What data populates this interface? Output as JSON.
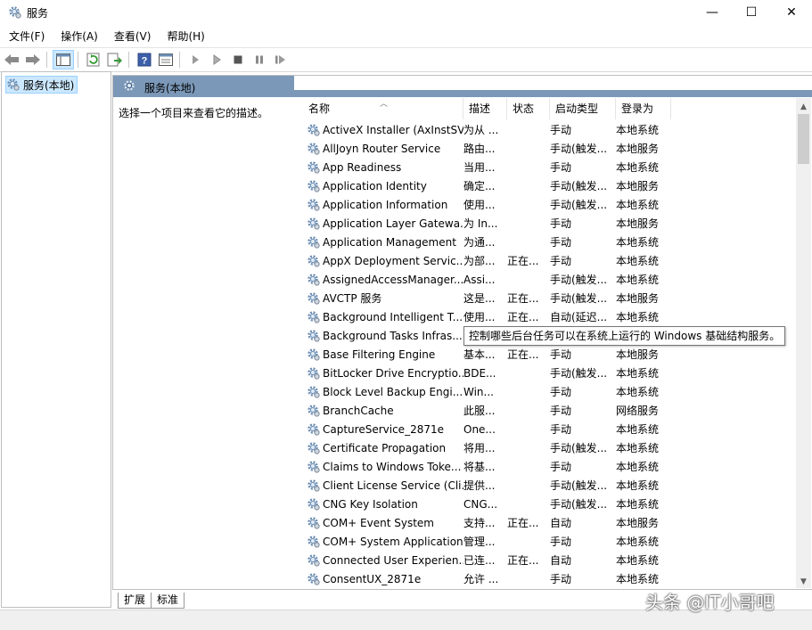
{
  "window": {
    "title": "服务",
    "minimize": "—",
    "maximize": "☐",
    "close": "✕"
  },
  "menu": [
    "文件(F)",
    "操作(A)",
    "查看(V)",
    "帮助(H)"
  ],
  "toolbar": {
    "icons": [
      "back-arrow-icon",
      "forward-arrow-icon",
      "console-tree-icon",
      "refresh-icon",
      "export-icon",
      "help-icon",
      "properties-icon",
      "start-service-icon",
      "start-alt-icon",
      "stop-icon",
      "pause-icon",
      "restart-icon"
    ]
  },
  "tree": {
    "item": "服务(本地)"
  },
  "panel": {
    "header": "服务(本地)",
    "description": "选择一个项目来查看它的描述。"
  },
  "columns": {
    "name": "名称",
    "desc": "描述",
    "state": "状态",
    "startup": "启动类型",
    "logon": "登录为"
  },
  "services": [
    {
      "name": "ActiveX Installer (AxInstSV)",
      "desc": "为从 ...",
      "state": "",
      "startup": "手动",
      "logon": "本地系统"
    },
    {
      "name": "AllJoyn Router Service",
      "desc": "路由...",
      "state": "",
      "startup": "手动(触发...",
      "logon": "本地服务"
    },
    {
      "name": "App Readiness",
      "desc": "当用...",
      "state": "",
      "startup": "手动",
      "logon": "本地系统"
    },
    {
      "name": "Application Identity",
      "desc": "确定...",
      "state": "",
      "startup": "手动(触发...",
      "logon": "本地服务"
    },
    {
      "name": "Application Information",
      "desc": "使用...",
      "state": "",
      "startup": "手动(触发...",
      "logon": "本地系统"
    },
    {
      "name": "Application Layer Gatewa...",
      "desc": "为 In...",
      "state": "",
      "startup": "手动",
      "logon": "本地服务"
    },
    {
      "name": "Application Management",
      "desc": "为通...",
      "state": "",
      "startup": "手动",
      "logon": "本地系统"
    },
    {
      "name": "AppX Deployment Servic...",
      "desc": "为部...",
      "state": "正在...",
      "startup": "手动",
      "logon": "本地系统"
    },
    {
      "name": "AssignedAccessManager...",
      "desc": "Assi...",
      "state": "",
      "startup": "手动(触发...",
      "logon": "本地系统"
    },
    {
      "name": "AVCTP 服务",
      "desc": "这是...",
      "state": "正在...",
      "startup": "手动(触发...",
      "logon": "本地服务"
    },
    {
      "name": "Background Intelligent T...",
      "desc": "使用...",
      "state": "正在...",
      "startup": "自动(延迟...",
      "logon": "本地系统"
    },
    {
      "name": "Background Tasks Infras...",
      "desc": "",
      "state": "",
      "startup": "",
      "logon": ""
    },
    {
      "name": "Base Filtering Engine",
      "desc": "基本...",
      "state": "正在...",
      "startup": "手动",
      "logon": "本地服务"
    },
    {
      "name": "BitLocker Drive Encryptio...",
      "desc": "BDE...",
      "state": "",
      "startup": "手动(触发...",
      "logon": "本地系统"
    },
    {
      "name": "Block Level Backup Engi...",
      "desc": "Win...",
      "state": "",
      "startup": "手动",
      "logon": "本地系统"
    },
    {
      "name": "BranchCache",
      "desc": "此服...",
      "state": "",
      "startup": "手动",
      "logon": "网络服务"
    },
    {
      "name": "CaptureService_2871e",
      "desc": "One...",
      "state": "",
      "startup": "手动",
      "logon": "本地系统"
    },
    {
      "name": "Certificate Propagation",
      "desc": "将用...",
      "state": "",
      "startup": "手动(触发...",
      "logon": "本地系统"
    },
    {
      "name": "Claims to Windows Toke...",
      "desc": "将基...",
      "state": "",
      "startup": "手动",
      "logon": "本地系统"
    },
    {
      "name": "Client License Service (Cli...",
      "desc": "提供...",
      "state": "",
      "startup": "手动(触发...",
      "logon": "本地系统"
    },
    {
      "name": "CNG Key Isolation",
      "desc": "CNG...",
      "state": "",
      "startup": "手动(触发...",
      "logon": "本地系统"
    },
    {
      "name": "COM+ Event System",
      "desc": "支持...",
      "state": "正在...",
      "startup": "自动",
      "logon": "本地服务"
    },
    {
      "name": "COM+ System Application",
      "desc": "管理...",
      "state": "",
      "startup": "手动",
      "logon": "本地系统"
    },
    {
      "name": "Connected User Experien...",
      "desc": "已连...",
      "state": "正在...",
      "startup": "自动",
      "logon": "本地系统"
    },
    {
      "name": "ConsentUX_2871e",
      "desc": "允许 ...",
      "state": "",
      "startup": "手动",
      "logon": "本地系统"
    }
  ],
  "tooltip": "控制哪些后台任务可以在系统上运行的 Windows 基础结构服务。",
  "tabs": [
    "扩展",
    "标准"
  ],
  "watermark": "头条 @IT小哥吧"
}
